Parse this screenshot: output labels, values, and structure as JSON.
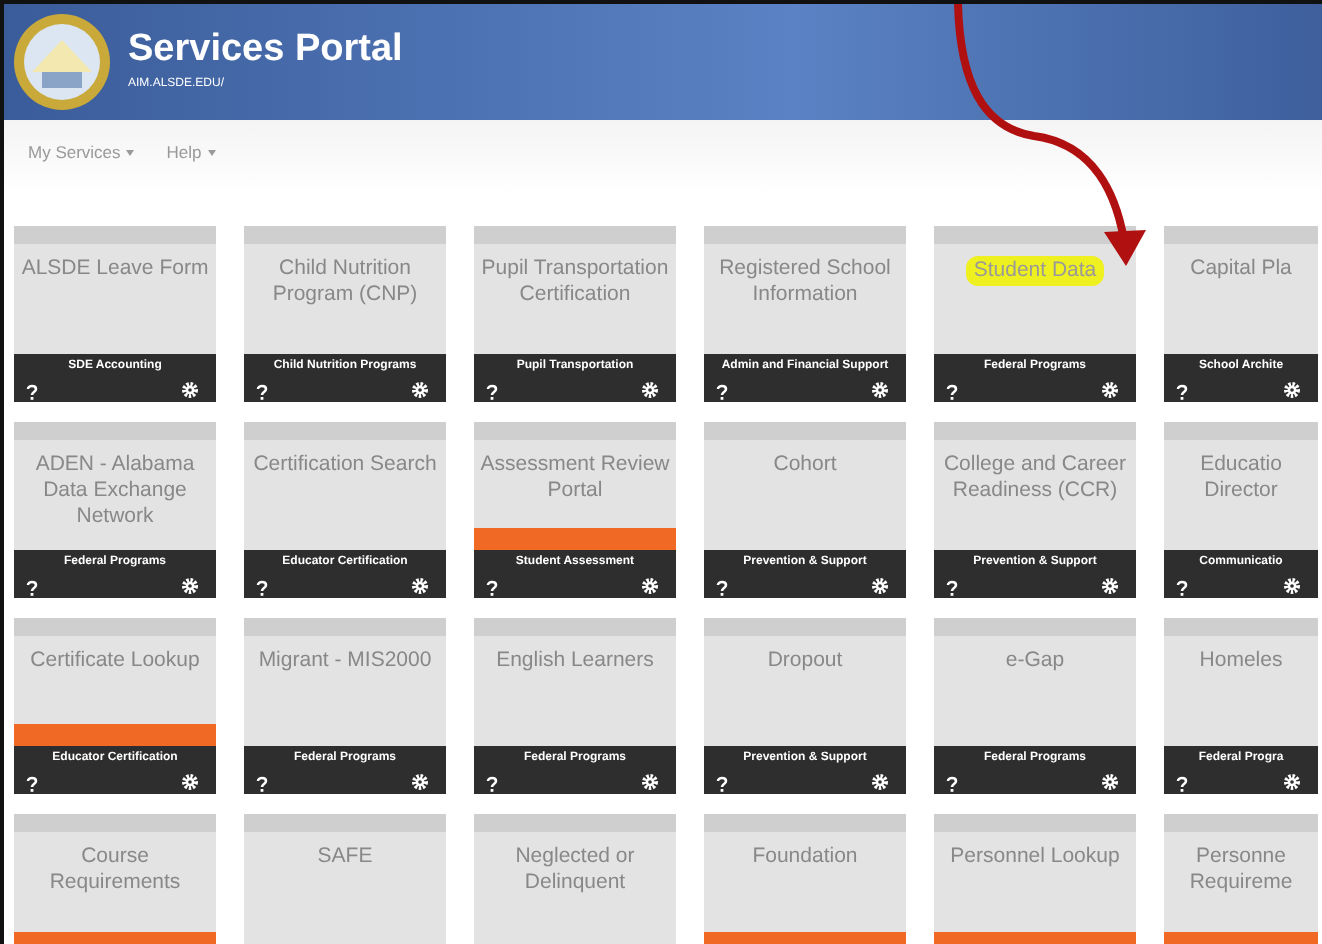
{
  "header": {
    "title": "Services Portal",
    "subtitle": "AIM.ALSDE.EDU/"
  },
  "menu": [
    {
      "label": "My Services",
      "dropdown": true
    },
    {
      "label": "Help",
      "dropdown": true
    }
  ],
  "annotation": {
    "arrow": true
  },
  "tiles": [
    {
      "title": "ALSDE Leave Form",
      "category": "SDE Accounting",
      "alert": false,
      "highlighted": false
    },
    {
      "title": "Child Nutrition Program (CNP)",
      "category": "Child Nutrition Programs",
      "alert": false,
      "highlighted": false
    },
    {
      "title": "Pupil Transportation Certification",
      "category": "Pupil Transportation",
      "alert": false,
      "highlighted": false
    },
    {
      "title": "Registered School Information",
      "category": "Admin and Financial Support",
      "alert": false,
      "highlighted": false
    },
    {
      "title": "Student Data",
      "category": "Federal Programs",
      "alert": false,
      "highlighted": true
    },
    {
      "title": "Capital Pla",
      "category": "School Archite",
      "alert": false,
      "highlighted": false
    },
    {
      "title": "ADEN - Alabama Data Exchange Network",
      "category": "Federal Programs",
      "alert": false,
      "highlighted": false
    },
    {
      "title": "Certification Search",
      "category": "Educator Certification",
      "alert": false,
      "highlighted": false
    },
    {
      "title": "Assessment Review Portal",
      "category": "Student Assessment",
      "alert": true,
      "highlighted": false
    },
    {
      "title": "Cohort",
      "category": "Prevention & Support",
      "alert": false,
      "highlighted": false
    },
    {
      "title": "College and Career Readiness (CCR)",
      "category": "Prevention & Support",
      "alert": false,
      "highlighted": false
    },
    {
      "title": "Educatio Director",
      "category": "Communicatio",
      "alert": false,
      "highlighted": false
    },
    {
      "title": "Certificate Lookup",
      "category": "Educator Certification",
      "alert": true,
      "highlighted": false
    },
    {
      "title": "Migrant - MIS2000",
      "category": "Federal Programs",
      "alert": false,
      "highlighted": false
    },
    {
      "title": "English Learners",
      "category": "Federal Programs",
      "alert": false,
      "highlighted": false
    },
    {
      "title": "Dropout",
      "category": "Prevention & Support",
      "alert": false,
      "highlighted": false
    },
    {
      "title": "e-Gap",
      "category": "Federal Programs",
      "alert": false,
      "highlighted": false
    },
    {
      "title": "Homeles",
      "category": "Federal Progra",
      "alert": false,
      "highlighted": false
    },
    {
      "title": "Course Requirements",
      "alert": true,
      "highlighted": false
    },
    {
      "title": "SAFE",
      "alert": false,
      "highlighted": false
    },
    {
      "title": "Neglected or Delinquent",
      "alert": false,
      "highlighted": false
    },
    {
      "title": "Foundation",
      "alert": true,
      "highlighted": false
    },
    {
      "title": "Personnel Lookup",
      "alert": true,
      "highlighted": false
    },
    {
      "title": "Personne Requireme",
      "alert": true,
      "highlighted": false
    }
  ]
}
